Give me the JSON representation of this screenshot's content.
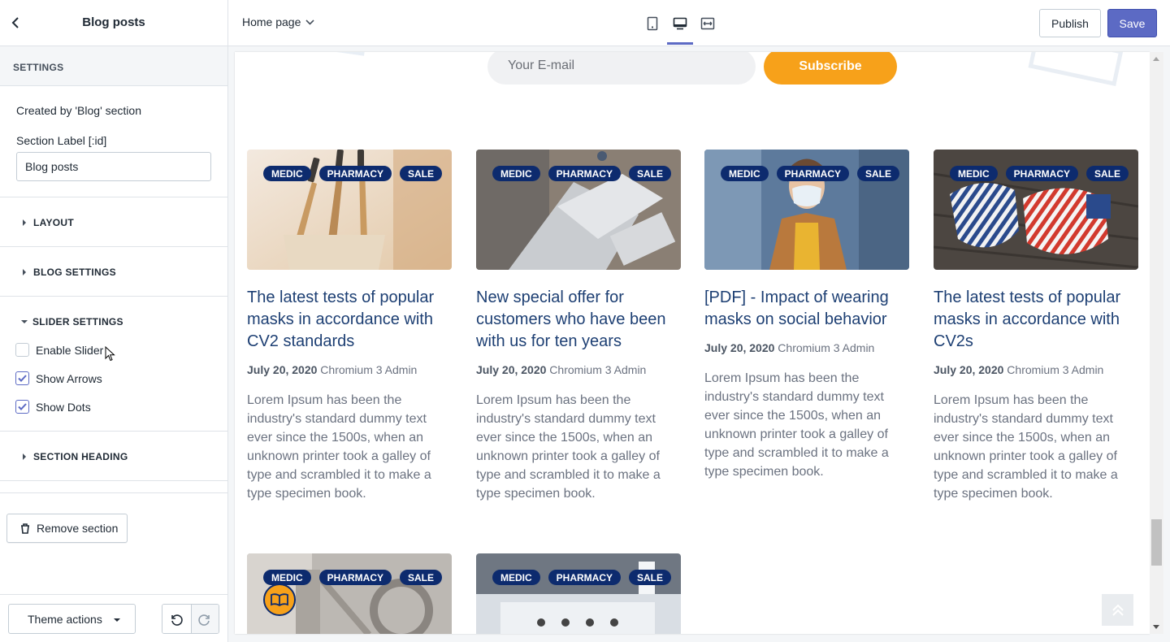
{
  "sidebar": {
    "title": "Blog posts",
    "settings_label": "SETTINGS",
    "created_by": "Created by 'Blog' section",
    "section_label_title": "Section Label [:id]",
    "section_label_value": "Blog posts",
    "sections": {
      "layout": "LAYOUT",
      "blog_settings": "BLOG SETTINGS",
      "slider_settings": "SLIDER SETTINGS",
      "section_heading": "SECTION HEADING"
    },
    "slider_options": [
      {
        "label": "Enable Slider",
        "checked": false
      },
      {
        "label": "Show Arrows",
        "checked": true
      },
      {
        "label": "Show Dots",
        "checked": true
      }
    ],
    "remove_label": "Remove section",
    "theme_actions_label": "Theme actions"
  },
  "topbar": {
    "page": "Home page",
    "publish_label": "Publish",
    "save_label": "Save",
    "active_device": "desktop"
  },
  "preview": {
    "email_placeholder": "Your E-mail",
    "subscribe_label": "Subscribe",
    "posts": [
      {
        "tags": [
          "MEDIC",
          "PHARMACY",
          "SALE"
        ],
        "title": "The latest tests of popular masks in accordance with CV2 standards",
        "date": "July 20, 2020",
        "author": "Chromium 3 Admin",
        "excerpt": "Lorem Ipsum has been the industry's standard dummy text ever since the 1500s, when an unknown printer took a galley of type and scrambled it to make a type specimen book."
      },
      {
        "tags": [
          "MEDIC",
          "PHARMACY",
          "SALE"
        ],
        "title": "New special offer for customers who have been with us for ten years",
        "date": "July 20, 2020",
        "author": "Chromium 3 Admin",
        "excerpt": "Lorem Ipsum has been the industry's standard dummy text ever since the 1500s, when an unknown printer took a galley of type and scrambled it to make a type specimen book."
      },
      {
        "tags": [
          "MEDIC",
          "PHARMACY",
          "SALE"
        ],
        "title": "[PDF] - Impact of wearing masks on social behavior",
        "date": "July 20, 2020",
        "author": "Chromium 3 Admin",
        "excerpt": "Lorem Ipsum has been the industry's standard dummy text ever since the 1500s, when an unknown printer took a galley of type and scrambled it to make a type specimen book."
      },
      {
        "tags": [
          "MEDIC",
          "PHARMACY",
          "SALE"
        ],
        "title": "The latest tests of popular masks in accordance with CV2s",
        "date": "July 20, 2020",
        "author": "Chromium 3 Admin",
        "excerpt": "Lorem Ipsum has been the industry's standard dummy text ever since the 1500s, when an unknown printer took a galley of type and scrambled it to make a type specimen book."
      },
      {
        "tags": [
          "MEDIC",
          "PHARMACY",
          "SALE"
        ]
      },
      {
        "tags": [
          "MEDIC",
          "PHARMACY",
          "SALE"
        ]
      }
    ]
  },
  "colors": {
    "accent": "#5c6ac4",
    "tag_bg": "#0d2b6e",
    "subscribe": "#f7a11a",
    "title": "#1d3f73"
  }
}
